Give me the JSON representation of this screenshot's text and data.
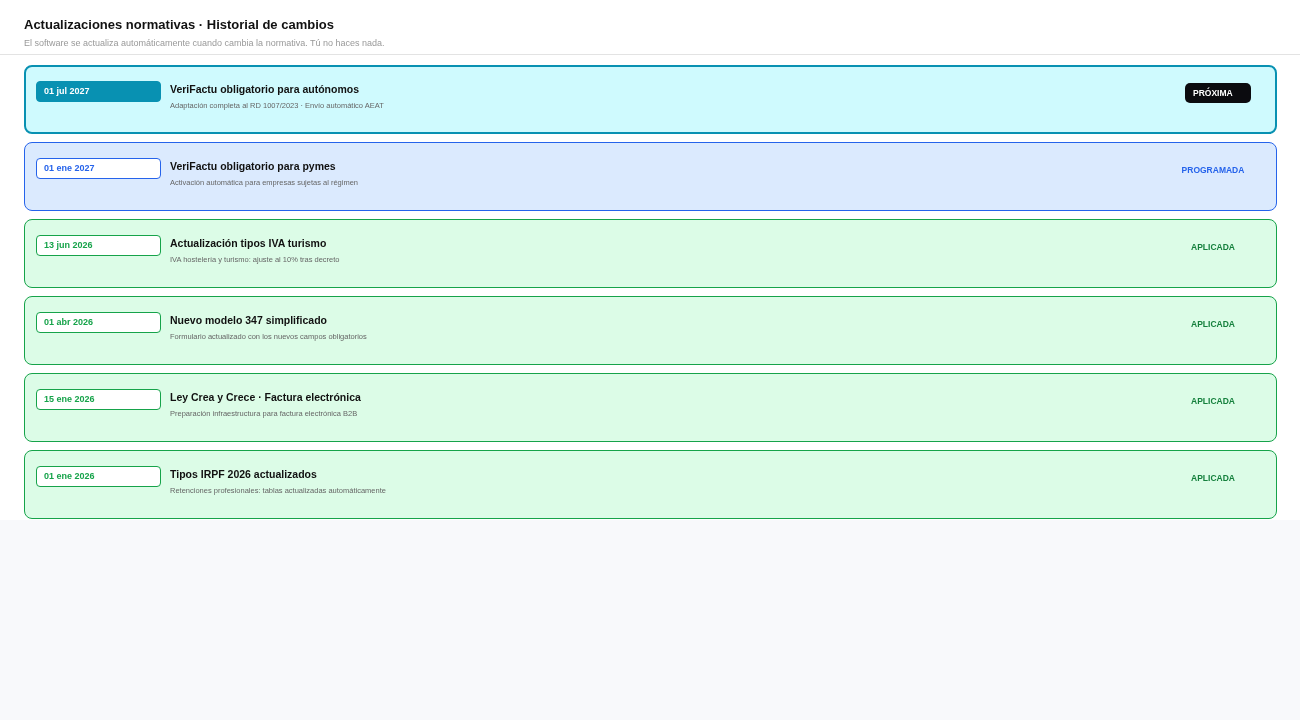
{
  "header": {
    "title": "Actualizaciones normativas · Historial de cambios",
    "subtitle": "El software se actualiza automáticamente cuando cambia la normativa. Tú no haces nada."
  },
  "updates": [
    {
      "date": "01 jul 2027",
      "title": "VeriFactu obligatorio para autónomos",
      "description": "Adaptación completa al RD 1007/2023 · Envío automático AEAT",
      "status": "PRÓXIMA",
      "kind": "next"
    },
    {
      "date": "01 ene 2027",
      "title": "VeriFactu obligatorio para pymes",
      "description": "Activación automática para empresas sujetas al régimen",
      "status": "PROGRAMADA",
      "kind": "scheduled"
    },
    {
      "date": "13 jun 2026",
      "title": "Actualización tipos IVA turismo",
      "description": "IVA hostelería y turismo: ajuste al 10% tras decreto",
      "status": "APLICADA",
      "kind": "applied"
    },
    {
      "date": "01 abr 2026",
      "title": "Nuevo modelo 347 simplificado",
      "description": "Formulario actualizado con los nuevos campos obligatorios",
      "status": "APLICADA",
      "kind": "applied"
    },
    {
      "date": "15 ene 2026",
      "title": "Ley Crea y Crece · Factura electrónica",
      "description": "Preparación infraestructura para factura electrónica B2B",
      "status": "APLICADA",
      "kind": "applied"
    },
    {
      "date": "01 ene 2026",
      "title": "Tipos IRPF 2026 actualizados",
      "description": "Retenciones profesionales: tablas actualizadas automáticamente",
      "status": "APLICADA",
      "kind": "applied"
    }
  ]
}
